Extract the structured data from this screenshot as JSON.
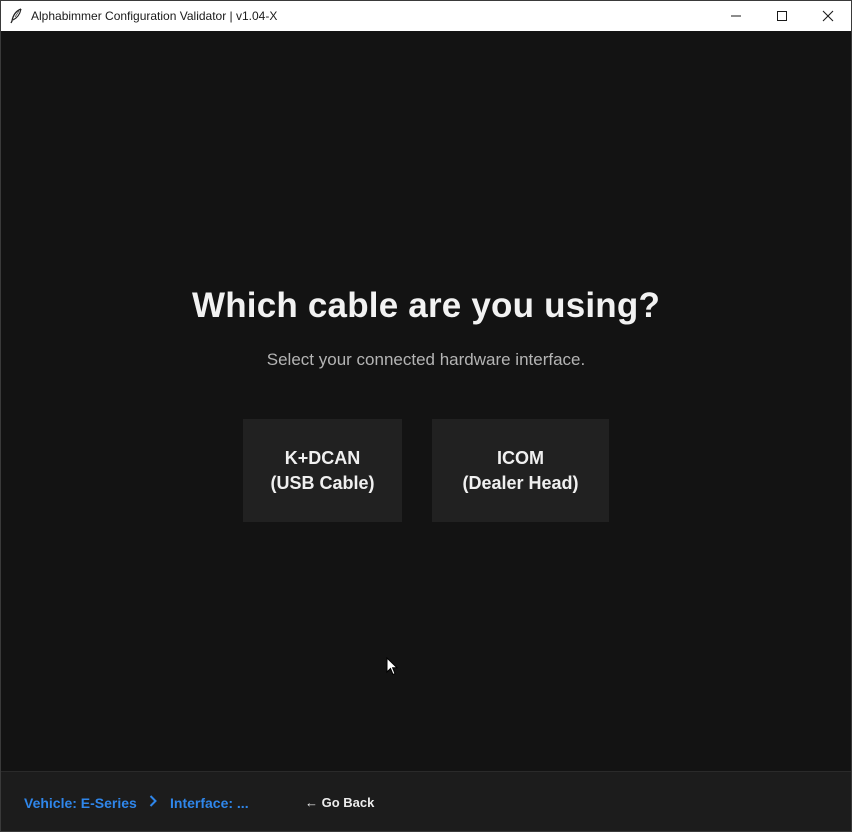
{
  "window": {
    "title": "Alphabimmer Configuration Validator | v1.04-X",
    "icon": "feather-icon",
    "controls": {
      "minimize": "minimize-icon",
      "maximize": "maximize-icon",
      "close": "close-icon"
    }
  },
  "main": {
    "heading": "Which cable are you using?",
    "subheading": "Select your connected hardware interface.",
    "options": [
      {
        "line1": "K+DCAN",
        "line2": "(USB Cable)"
      },
      {
        "line1": "ICOM",
        "line2": "(Dealer Head)"
      }
    ]
  },
  "footer": {
    "breadcrumb": [
      "Vehicle: E-Series",
      "Interface: ..."
    ],
    "separator_icon": "chevron-right-icon",
    "go_back": "← Go Back"
  },
  "colors": {
    "background": "#131313",
    "titlebar": "#ffffff",
    "card": "#212121",
    "footer": "#1c1c1c",
    "accent": "#2f86ea",
    "heading": "#f2f2f2",
    "subtext": "#b4b4b4"
  }
}
